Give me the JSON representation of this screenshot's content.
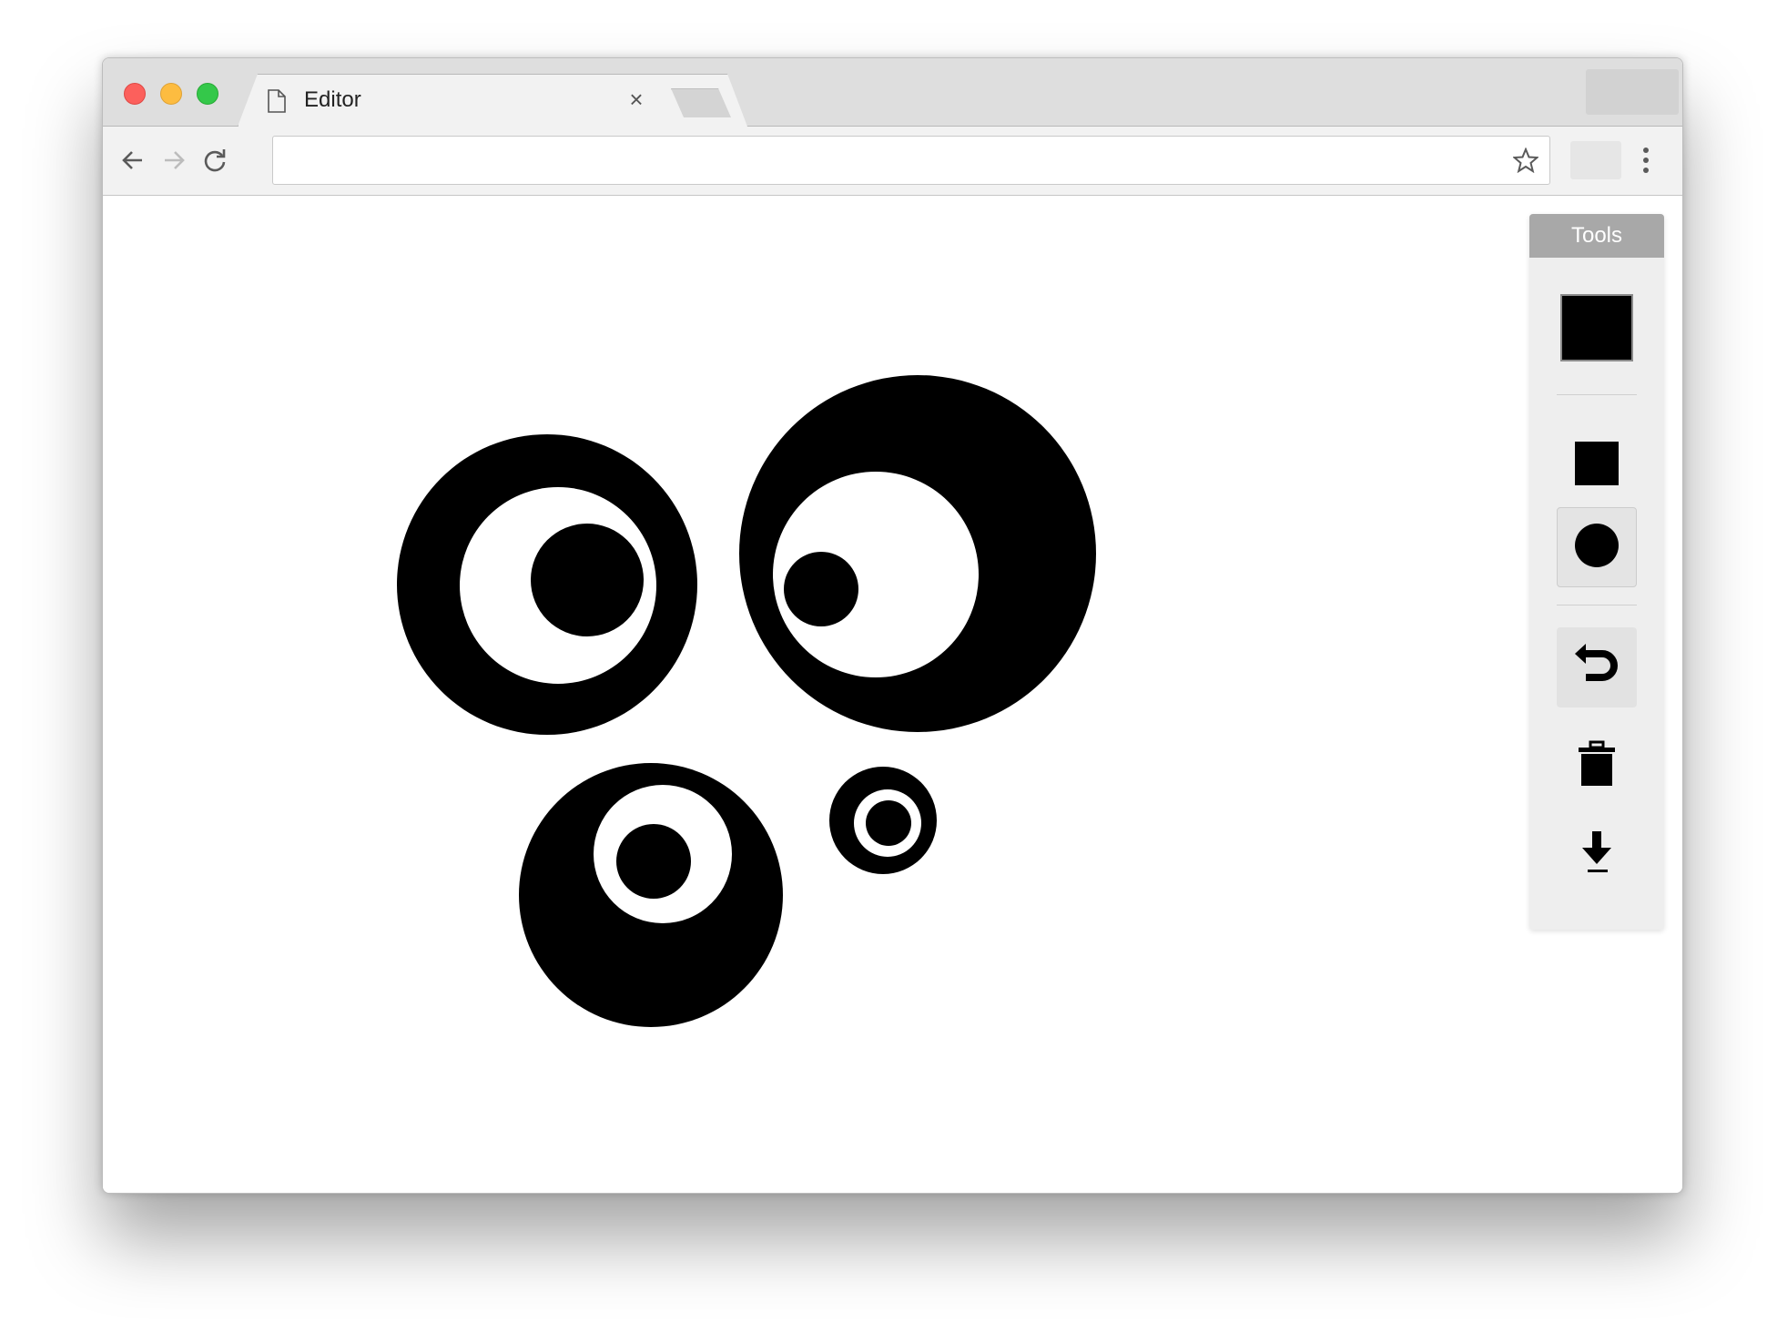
{
  "window": {
    "tab": {
      "title": "Editor",
      "close_glyph": "×",
      "icon": "document-icon"
    },
    "toolbar": {
      "back_icon": "arrow-left-icon",
      "forward_icon": "arrow-right-icon",
      "reload_icon": "reload-icon",
      "address_value": "",
      "bookmark_icon": "star-icon",
      "menu_icon": "vertical-dots-icon"
    }
  },
  "editor": {
    "tools": {
      "header": "Tools",
      "current_color": "#000000",
      "items": [
        {
          "name": "rectangle-tool",
          "icon": "square-icon",
          "selected": false
        },
        {
          "name": "circle-tool",
          "icon": "circle-icon",
          "selected": true
        },
        {
          "name": "undo-tool",
          "icon": "undo-icon",
          "selected": false
        },
        {
          "name": "delete-tool",
          "icon": "trash-icon",
          "selected": false
        },
        {
          "name": "download-tool",
          "icon": "download-icon",
          "selected": false
        }
      ]
    },
    "colors": {
      "ink": "#000000",
      "paper": "#ffffff"
    }
  }
}
